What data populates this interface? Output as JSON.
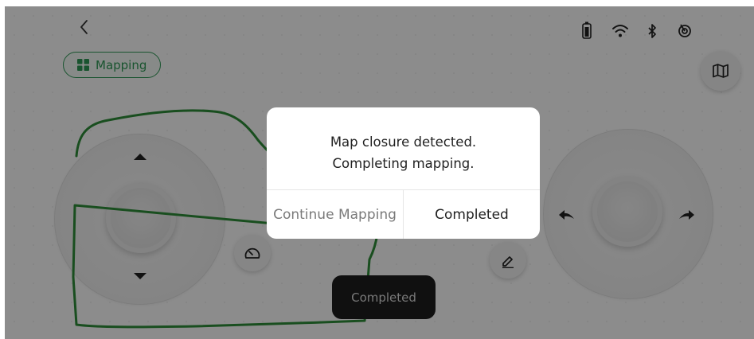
{
  "header": {
    "mode_label": "Mapping"
  },
  "status_icons": [
    "battery-icon",
    "wifi-icon",
    "bluetooth-icon",
    "signal-icon"
  ],
  "colors": {
    "accent": "#2f9a57",
    "path": "#2f8f3a",
    "toast_bg": "#1e1e1e",
    "overlay": "rgba(0,0,0,0.45)"
  },
  "toast": {
    "text": "Completed"
  },
  "dialog": {
    "line1": "Map closure detected.",
    "line2": "Completing mapping.",
    "cancel_label": "Continue Mapping",
    "confirm_label": "Completed"
  }
}
